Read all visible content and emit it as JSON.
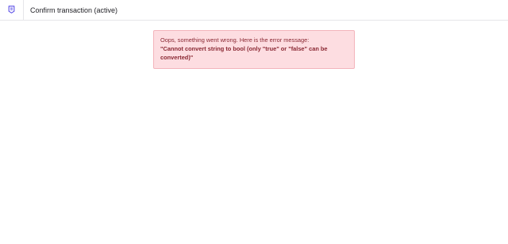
{
  "header": {
    "icon": "document-badge-icon",
    "title": "Confirm transaction (active)"
  },
  "error": {
    "intro": "Oops, something went wrong. Here is the error message:",
    "message": "\"Cannot convert string to bool (only \"true\" or \"false\" can be converted)\""
  },
  "colors": {
    "accent": "#5b4fe6",
    "error_background": "#fddde1",
    "error_border": "#f3b4bc",
    "error_text": "#8a2833",
    "divider": "#e6e6e9"
  }
}
